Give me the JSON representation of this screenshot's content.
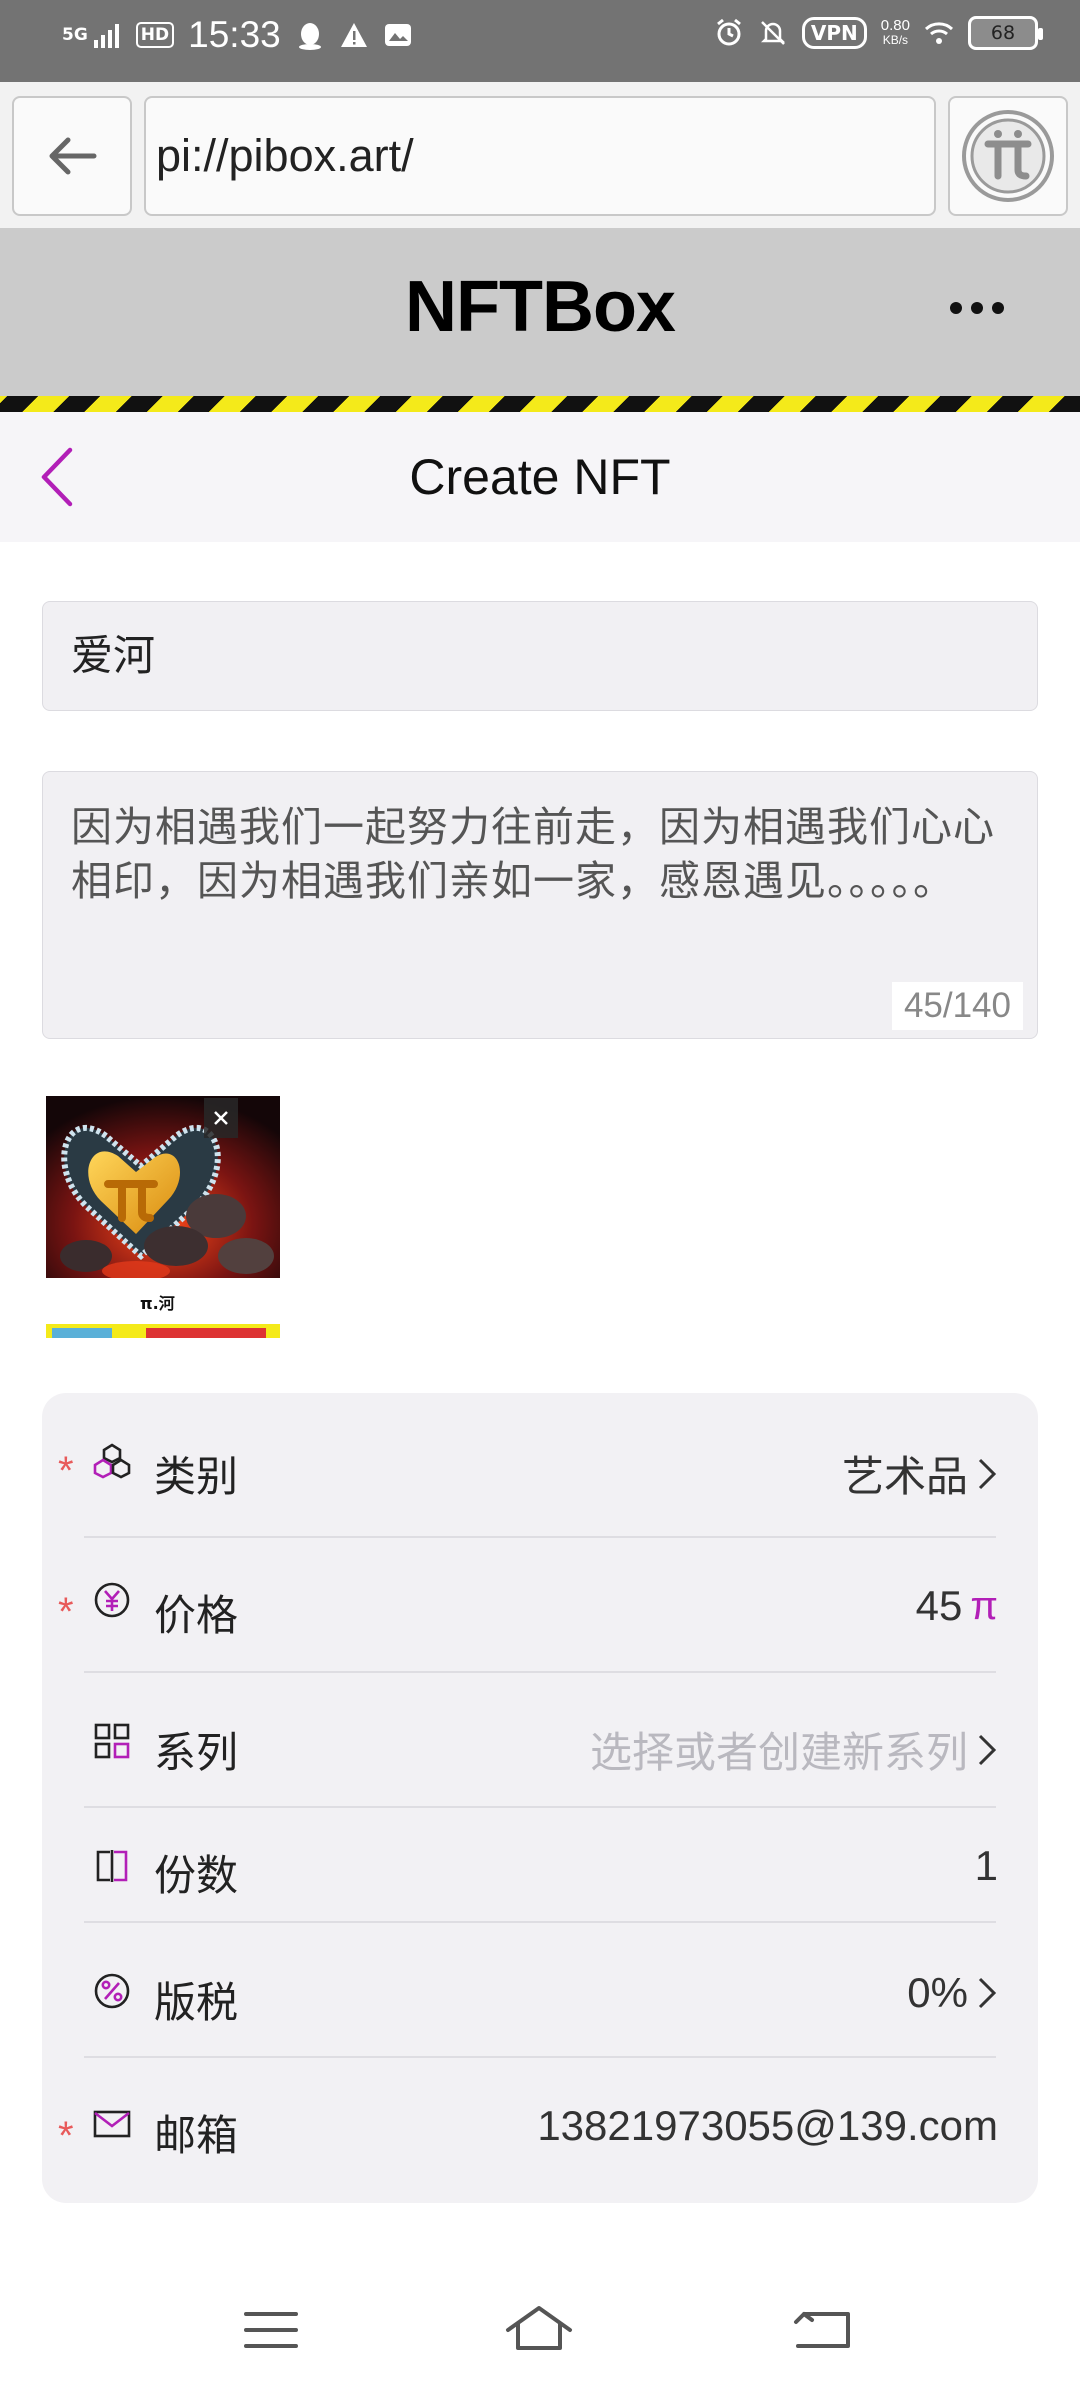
{
  "status_bar": {
    "network": "5G",
    "hd": "HD",
    "time": "15:33",
    "vpn": "VPN",
    "speed_value": "0.80",
    "speed_unit": "KB/s",
    "battery": "68"
  },
  "browser": {
    "url": "pi://pibox.art/"
  },
  "app_header": {
    "title": "NFTBox"
  },
  "page": {
    "title": "Create NFT"
  },
  "form": {
    "name_value": "爱河",
    "description_value": "因为相遇我们一起努力往前走，因为相遇我们心心相印，因为相遇我们亲如一家，感恩遇见。。。。。",
    "description_count": "45/140",
    "image_caption": "π.河"
  },
  "settings": {
    "rows": [
      {
        "label": "类别",
        "value": "艺术品",
        "required": true,
        "icon": "category-icon",
        "chevron": true
      },
      {
        "label": "价格",
        "value": "45",
        "unit": "π",
        "required": true,
        "icon": "price-icon",
        "chevron": false
      },
      {
        "label": "系列",
        "value": "选择或者创建新系列",
        "required": false,
        "icon": "collection-icon",
        "chevron": true,
        "placeholder": true
      },
      {
        "label": "份数",
        "value": "1",
        "required": false,
        "icon": "copies-icon",
        "chevron": false
      },
      {
        "label": "版税",
        "value": "0%",
        "required": false,
        "icon": "royalty-icon",
        "chevron": true
      },
      {
        "label": "邮箱",
        "value": "13821973055@139.com",
        "required": true,
        "icon": "mail-icon",
        "chevron": false
      }
    ],
    "required_mark": "*"
  },
  "colors": {
    "accent": "#b21fb7",
    "required": "#e85a5a",
    "header_bg": "#cbcbcb",
    "hazard_yellow": "#f4ea1a"
  }
}
